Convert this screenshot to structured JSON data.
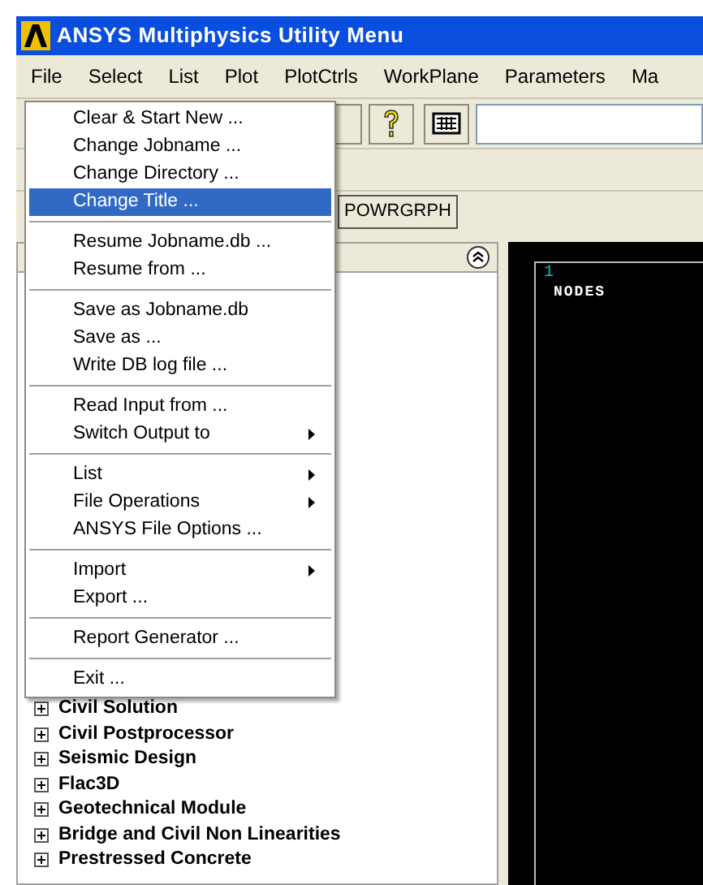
{
  "window": {
    "title": "ANSYS Multiphysics Utility Menu"
  },
  "menu_bar": [
    "File",
    "Select",
    "List",
    "Plot",
    "PlotCtrls",
    "WorkPlane",
    "Parameters",
    "Ma"
  ],
  "file_menu": {
    "groups": [
      [
        {
          "label": "Clear & Start New ...",
          "selected": false,
          "submenu": false
        },
        {
          "label": "Change Jobname ...",
          "selected": false,
          "submenu": false
        },
        {
          "label": "Change Directory ...",
          "selected": false,
          "submenu": false
        },
        {
          "label": "Change Title ...",
          "selected": true,
          "submenu": false
        }
      ],
      [
        {
          "label": "Resume Jobname.db ...",
          "selected": false,
          "submenu": false
        },
        {
          "label": "Resume from ...",
          "selected": false,
          "submenu": false
        }
      ],
      [
        {
          "label": "Save as Jobname.db",
          "selected": false,
          "submenu": false
        },
        {
          "label": "Save as ...",
          "selected": false,
          "submenu": false
        },
        {
          "label": "Write DB log file ...",
          "selected": false,
          "submenu": false
        }
      ],
      [
        {
          "label": "Read Input from ...",
          "selected": false,
          "submenu": false
        },
        {
          "label": "Switch Output to",
          "selected": false,
          "submenu": true
        }
      ],
      [
        {
          "label": "List",
          "selected": false,
          "submenu": true
        },
        {
          "label": "File Operations",
          "selected": false,
          "submenu": true
        },
        {
          "label": "ANSYS File Options ...",
          "selected": false,
          "submenu": false
        }
      ],
      [
        {
          "label": "Import",
          "selected": false,
          "submenu": true
        },
        {
          "label": "Export ...",
          "selected": false,
          "submenu": false
        }
      ],
      [
        {
          "label": "Report Generator ...",
          "selected": false,
          "submenu": false
        }
      ],
      [
        {
          "label": "Exit ...",
          "selected": false,
          "submenu": false
        }
      ]
    ]
  },
  "toolbar_buttons": [
    "POWRGRPH"
  ],
  "tree": {
    "items": [
      {
        "label": "Civil Solution",
        "expanded": false
      },
      {
        "label": "Civil Postprocessor",
        "expanded": false
      },
      {
        "label": "Seismic Design",
        "expanded": false
      },
      {
        "label": "Flac3D",
        "expanded": false
      },
      {
        "label": "Geotechnical Module",
        "expanded": false
      },
      {
        "label": "Bridge and Civil Non Linearities",
        "expanded": false
      },
      {
        "label": "Prestressed Concrete",
        "expanded": false
      }
    ]
  },
  "graphics": {
    "window_number": "1",
    "label": "NODES"
  }
}
